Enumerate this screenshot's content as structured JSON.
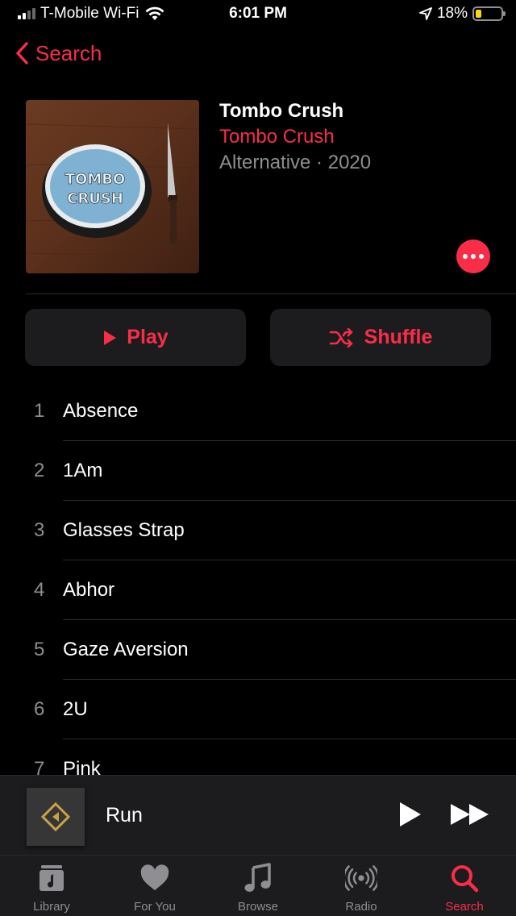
{
  "status_bar": {
    "carrier": "T-Mobile Wi-Fi",
    "time": "6:01 PM",
    "battery_percent": "18%",
    "battery_level": 0.18,
    "icons": [
      "cellular-signal-icon",
      "wifi-icon",
      "location-arrow-icon",
      "battery-icon"
    ]
  },
  "nav": {
    "back_label": "Search"
  },
  "album": {
    "title": "Tombo Crush",
    "artist": "Tombo Crush",
    "meta": "Alternative · 2020",
    "artwork_text": "TOMBO CRUSH"
  },
  "actions": {
    "play_label": "Play",
    "shuffle_label": "Shuffle"
  },
  "tracks": [
    {
      "number": "1",
      "title": "Absence"
    },
    {
      "number": "2",
      "title": "1Am"
    },
    {
      "number": "3",
      "title": "Glasses Strap"
    },
    {
      "number": "4",
      "title": "Abhor"
    },
    {
      "number": "5",
      "title": "Gaze Aversion"
    },
    {
      "number": "6",
      "title": "2U"
    },
    {
      "number": "7",
      "title": "Pink"
    }
  ],
  "now_playing": {
    "title": "Run"
  },
  "tab_bar": {
    "items": [
      {
        "label": "Library",
        "icon": "library-icon"
      },
      {
        "label": "For You",
        "icon": "heart-icon"
      },
      {
        "label": "Browse",
        "icon": "music-note-icon"
      },
      {
        "label": "Radio",
        "icon": "radio-icon"
      },
      {
        "label": "Search",
        "icon": "search-icon",
        "active": true
      }
    ]
  },
  "colors": {
    "accent": "#fa2d48",
    "background": "#000000",
    "secondary_text": "#8e8e93",
    "surface": "#1c1c1e"
  }
}
